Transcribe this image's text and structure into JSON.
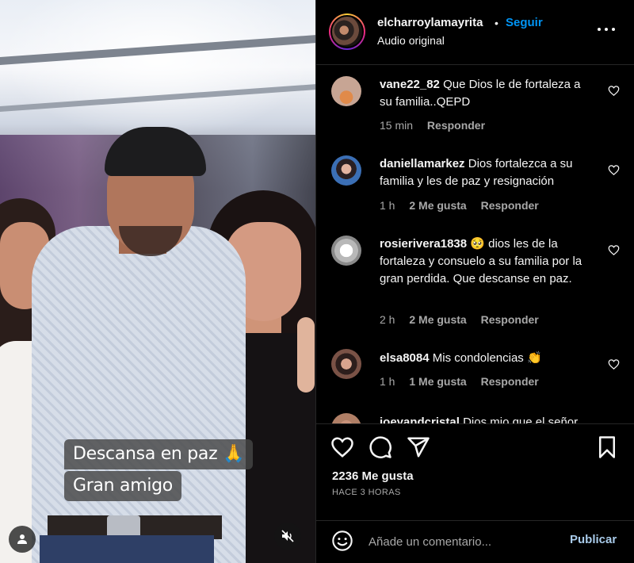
{
  "media": {
    "caption_line1": "Descansa en paz 🙏",
    "caption_line2": "Gran amigo",
    "user_tag_icon": "user-icon",
    "mute_icon": "speaker-muted-icon"
  },
  "header": {
    "username": "elcharroylamayrita",
    "separator": "•",
    "follow_label": "Seguir",
    "audio_label": "Audio original",
    "more_icon": "more-horizontal-icon"
  },
  "comments": [
    {
      "username": "vane22_82",
      "text": "Que Dios le de fortaleza a su familia..QEPD",
      "time": "15 min",
      "likes": "",
      "reply": "Responder",
      "avatar_color": "#c7a594"
    },
    {
      "username": "daniellamarkez",
      "text": "Dios fortalezca a su familia y les de paz y resignación",
      "time": "1 h",
      "likes": "2 Me gusta",
      "reply": "Responder",
      "avatar_color": "#3b6fb5"
    },
    {
      "username": "rosierivera1838",
      "text": "🥺 dios les de la fortaleza y consuelo a su familia por la gran perdida. Que descanse en paz.",
      "time": "2 h",
      "likes": "2 Me gusta",
      "reply": "Responder",
      "avatar_color": "#cfcfcf"
    },
    {
      "username": "elsa8084",
      "text": "Mis condolencias 👏",
      "time": "1 h",
      "likes": "1 Me gusta",
      "reply": "Responder",
      "avatar_color": "#7a5246"
    },
    {
      "username": "joeyandcristal",
      "text": "Dios mio que el señor",
      "time": "",
      "likes": "",
      "reply": "",
      "avatar_color": "#b07f66"
    }
  ],
  "actions": {
    "like_icon": "heart-icon",
    "comment_icon": "comment-icon",
    "share_icon": "send-icon",
    "save_icon": "bookmark-icon",
    "likes_count": "2236 Me gusta",
    "timestamp": "HACE 3 HORAS"
  },
  "add_comment": {
    "emoji_icon": "emoji-icon",
    "placeholder": "Añade un comentario...",
    "publish_label": "Publicar"
  },
  "colors": {
    "background": "#000000",
    "link_blue": "#0095f6",
    "publish_disabled": "#a9cbea",
    "secondary_text": "#a8a8a8"
  }
}
